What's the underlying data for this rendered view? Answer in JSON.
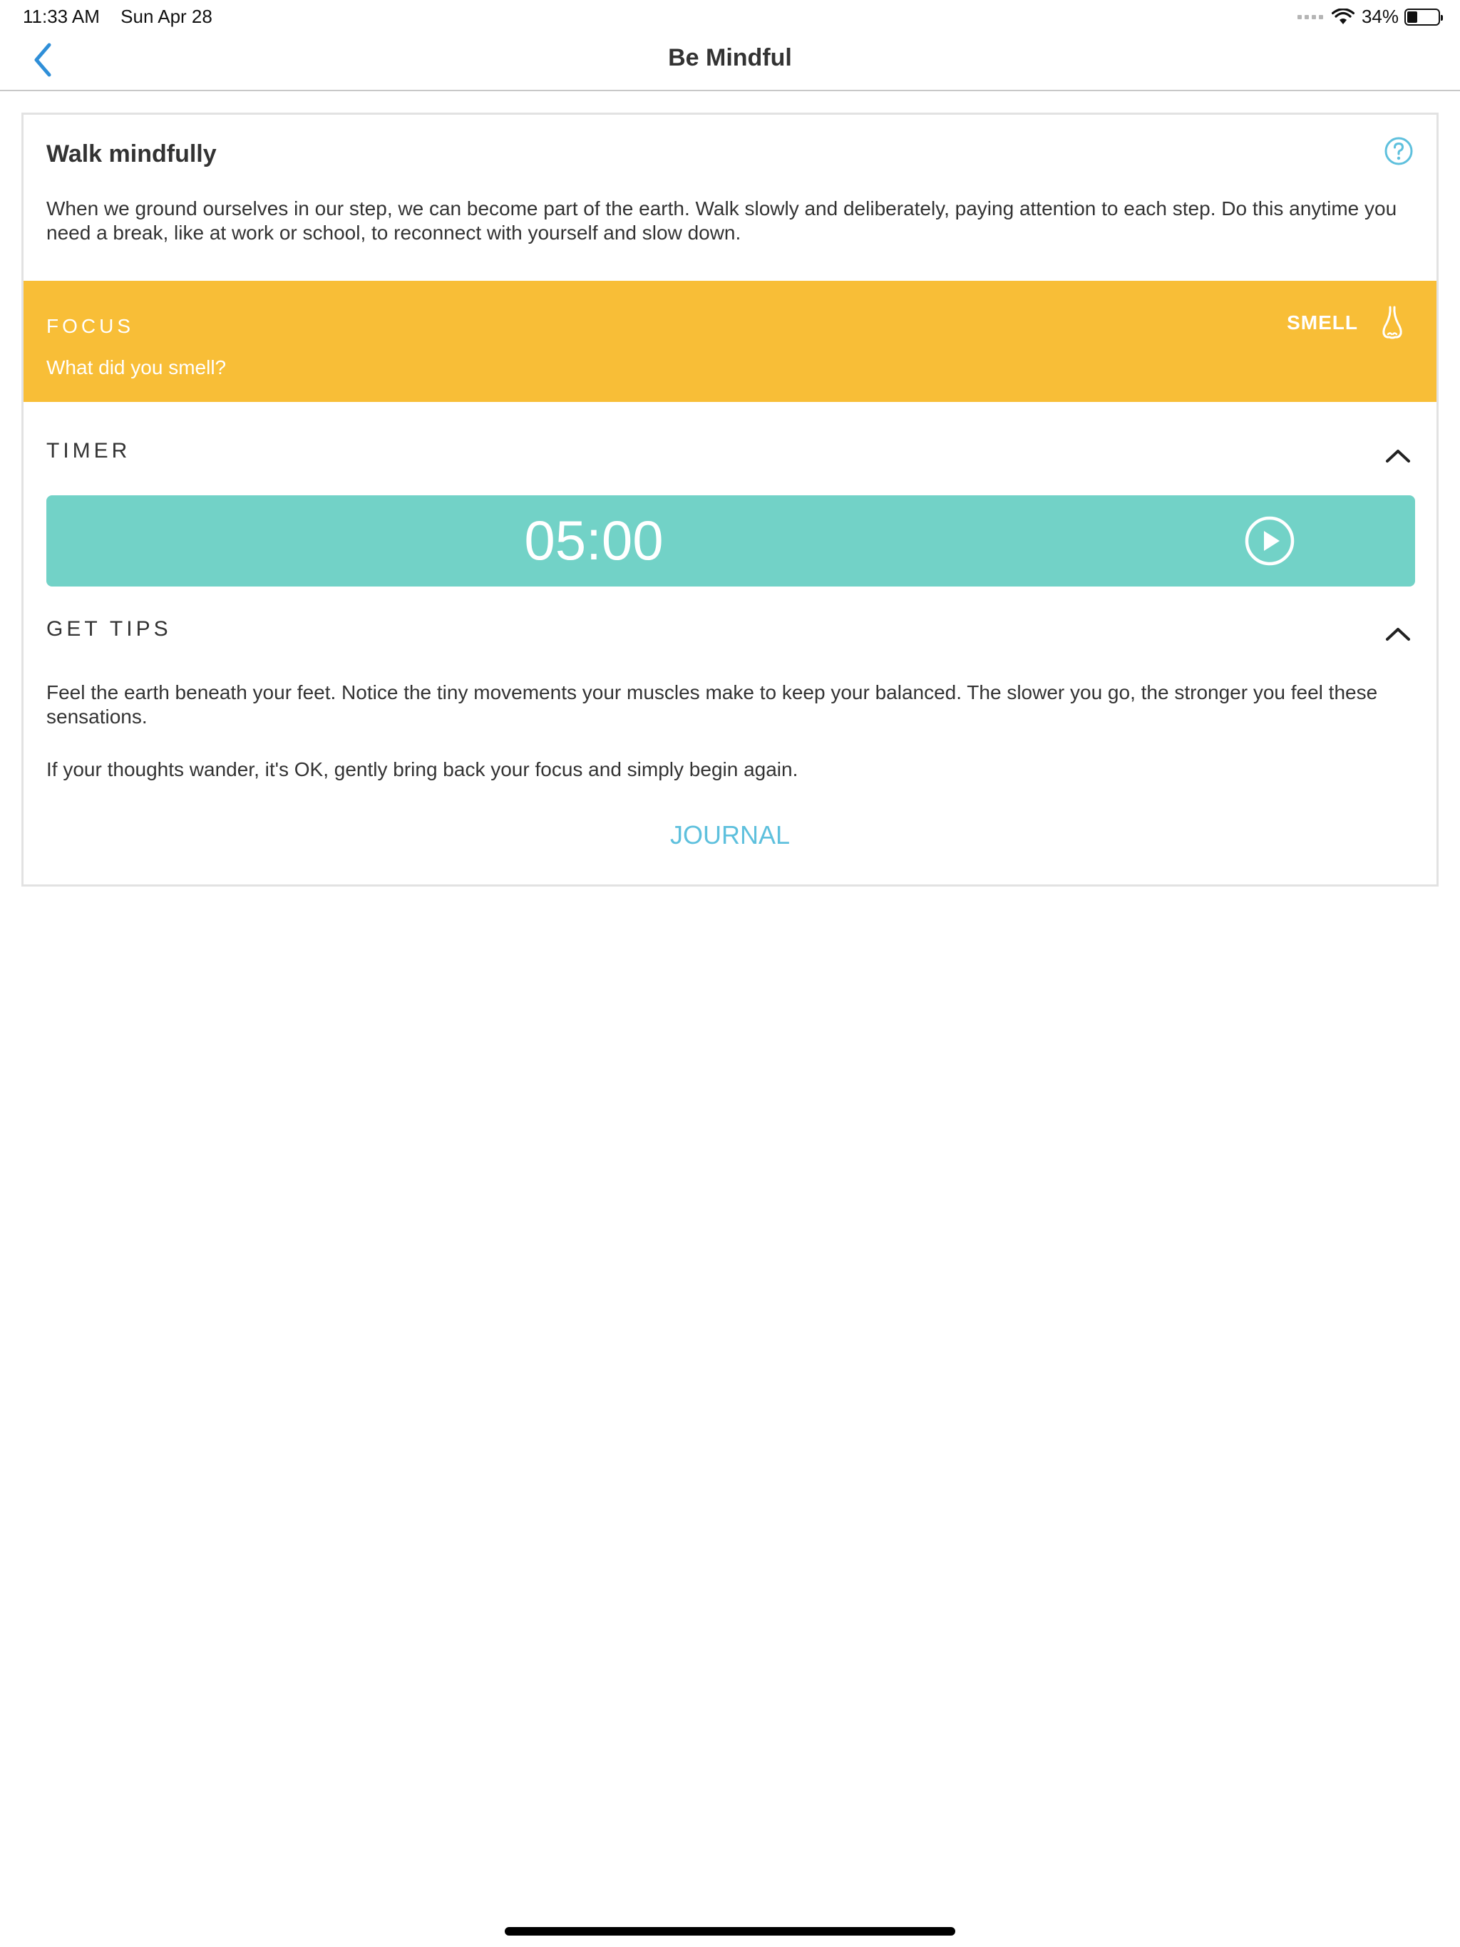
{
  "status_bar": {
    "time": "11:33 AM",
    "date": "Sun Apr 28",
    "battery_percent": "34%",
    "battery_level": 0.34
  },
  "nav": {
    "back_icon": "chevron-left-icon",
    "title": "Be Mindful"
  },
  "card": {
    "title": "Walk mindfully",
    "help_icon": "question-circle-icon",
    "description": "When we ground ourselves in our step, we can become part of the earth. Walk slowly and deliberately, paying attention to each step. Do this anytime you need a break, like at work or school, to reconnect with yourself and slow down."
  },
  "focus": {
    "label": "FOCUS",
    "prompt": "What did you smell?",
    "sense": "SMELL",
    "sense_icon": "nose-icon",
    "color": "#f8be37"
  },
  "timer": {
    "header": "TIMER",
    "value": "05:00",
    "play_icon": "play-circle-icon",
    "color": "#72d2c7"
  },
  "tips": {
    "header": "GET TIPS",
    "paragraphs": [
      "Feel the earth beneath your feet. Notice the tiny movements your muscles make to keep your balanced. The slower you go, the stronger you feel these sensations.",
      "If your thoughts wander, it's OK, gently bring back your focus and simply begin again."
    ]
  },
  "journal": {
    "label": "JOURNAL",
    "color": "#5ec0dd"
  }
}
